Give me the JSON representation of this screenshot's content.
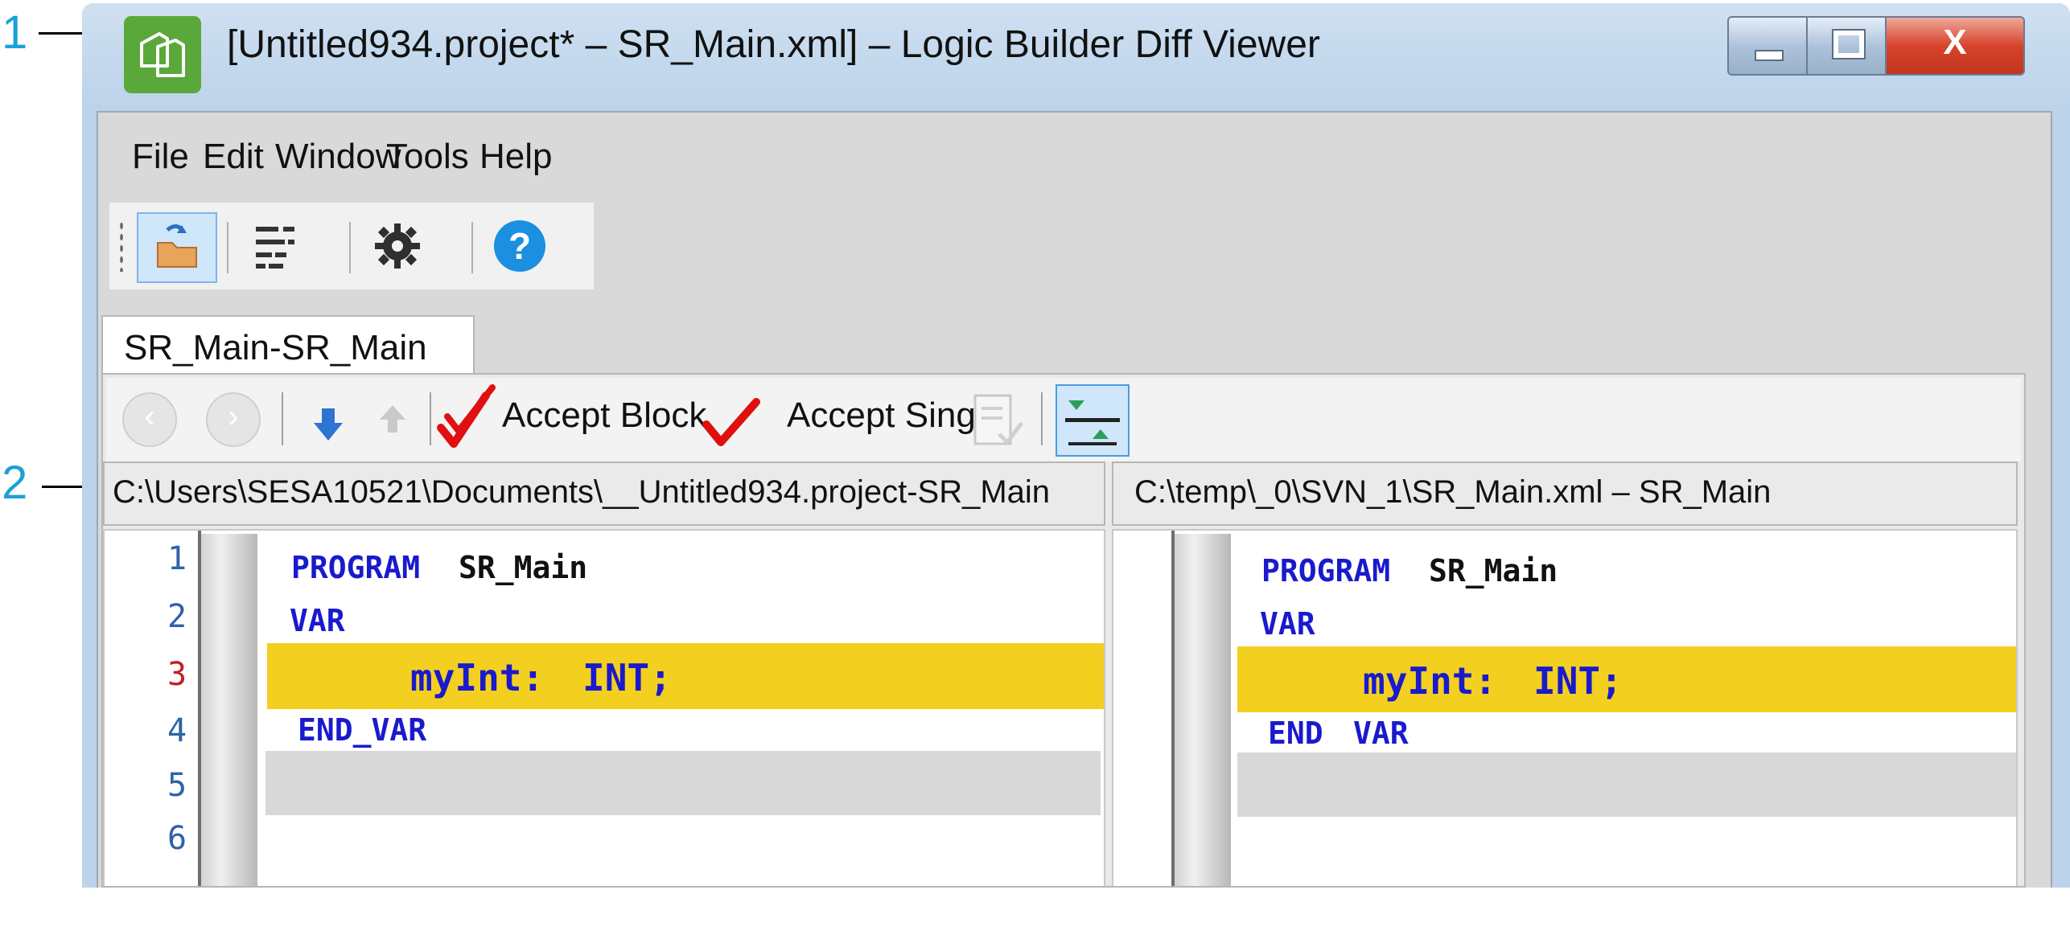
{
  "callouts": {
    "one": "1",
    "two": "2"
  },
  "window": {
    "title": "[Untitled934.project* – SR_Main.xml] – Logic Builder Diff Viewer",
    "app_icon": "documents-icon",
    "controls": {
      "minimize_icon": "minimize-icon",
      "maximize_icon": "maximize-icon",
      "close_icon": "close-icon",
      "close_glyph": "X"
    }
  },
  "menu": {
    "items": [
      "File",
      "Edit",
      "Window",
      "Tools",
      "Help"
    ]
  },
  "toolbar": {
    "buttons": [
      "open-folder-icon",
      "compare-lines-icon",
      "gear-icon",
      "help-icon"
    ]
  },
  "tab": {
    "label": "SR_Main-SR_Main"
  },
  "diff_toolbar": {
    "accept_block": "Accept Block",
    "accept_single": "Accept Single",
    "icons": [
      "previous-icon",
      "next-icon",
      "next-difference-icon",
      "previous-difference-icon",
      "accept-block-icon",
      "accept-single-icon",
      "accept-document-icon",
      "toggle-view-icon"
    ]
  },
  "left": {
    "path": "C:\\Users\\SESA10521\\Documents\\__Untitled934.project-SR_Main",
    "line_numbers": [
      "1",
      "2",
      "3",
      "4",
      "5",
      "6"
    ],
    "lines": {
      "l1_kw": "PROGRAM",
      "l1_id": "SR_Main",
      "l2": "VAR",
      "l3_id": "myInt:",
      "l3_kw": "INT;",
      "l4": "END_VAR"
    }
  },
  "right": {
    "path": "C:\\temp\\_0\\SVN_1\\SR_Main.xml – SR_Main",
    "lines": {
      "l1_kw": "PROGRAM",
      "l1_id": "SR_Main",
      "l2": "VAR",
      "l3_id": "myInt:",
      "l3_kw": "INT;",
      "l4a": "END",
      "l4b": "VAR"
    }
  },
  "colors": {
    "accent": "#1ba1d6",
    "changed_line": "#f3d020",
    "keyword": "#1a1acd",
    "app_icon": "#5aa83a",
    "close_button": "#d7432b"
  }
}
